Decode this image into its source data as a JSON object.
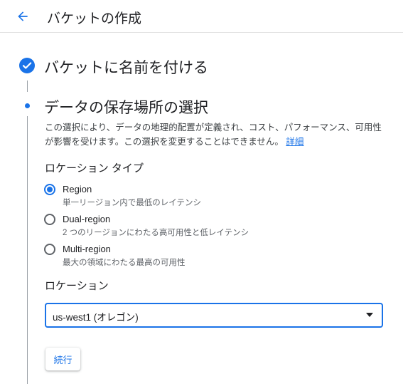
{
  "header": {
    "title": "バケットの作成"
  },
  "steps": {
    "step1": {
      "title": "バケットに名前を付ける"
    },
    "step2": {
      "title": "データの保存場所の選択",
      "description": "この選択により、データの地理的配置が定義され、コスト、パフォーマンス、可用性が影響を受けます。この選択を変更することはできません。",
      "details_link": "詳細"
    }
  },
  "location_type": {
    "label": "ロケーション タイプ",
    "options": [
      {
        "label": "Region",
        "description": "単一リージョン内で最低のレイテンシ",
        "selected": true
      },
      {
        "label": "Dual-region",
        "description": "2 つのリージョンにわたる高可用性と低レイテンシ",
        "selected": false
      },
      {
        "label": "Multi-region",
        "description": "最大の領域にわたる最高の可用性",
        "selected": false
      }
    ]
  },
  "location": {
    "label": "ロケーション",
    "selected_value": "us-west1 (オレゴン)"
  },
  "actions": {
    "continue_label": "続行"
  },
  "colors": {
    "accent": "#1a73e8",
    "text": "#202124",
    "secondary_text": "#5f6368"
  }
}
